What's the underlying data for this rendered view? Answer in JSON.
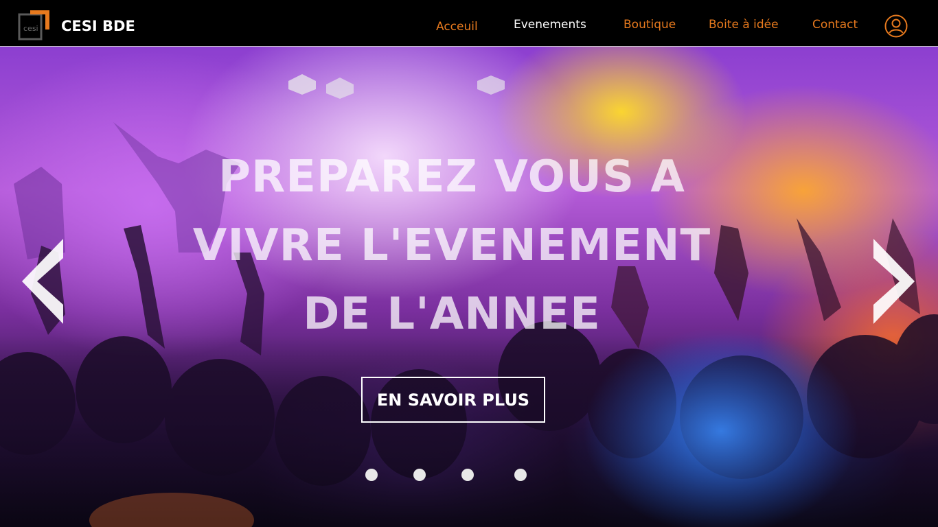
{
  "header": {
    "brand": "CESI BDE",
    "logo_text": "cesi",
    "nav": {
      "acceuil": "Acceuil",
      "evenements": "Evenements",
      "boutique": "Boutique",
      "boite": "Boite à idée",
      "contact": "Contact"
    },
    "user_icon": "user-circle-icon"
  },
  "hero": {
    "headline_line1": "PREPAREZ VOUS A",
    "headline_line2": "VIVRE L'EVENEMENT",
    "headline_line3": "DE L'ANNEE",
    "cta_label": "EN SAVOIR PLUS",
    "prev_icon": "chevron-left-icon",
    "next_icon": "chevron-right-icon",
    "slide_count": 4,
    "background": "concert-crowd-image"
  },
  "colors": {
    "nav_background": "#000000",
    "accent_orange": "#e87a1e",
    "text_white": "#ffffff"
  }
}
